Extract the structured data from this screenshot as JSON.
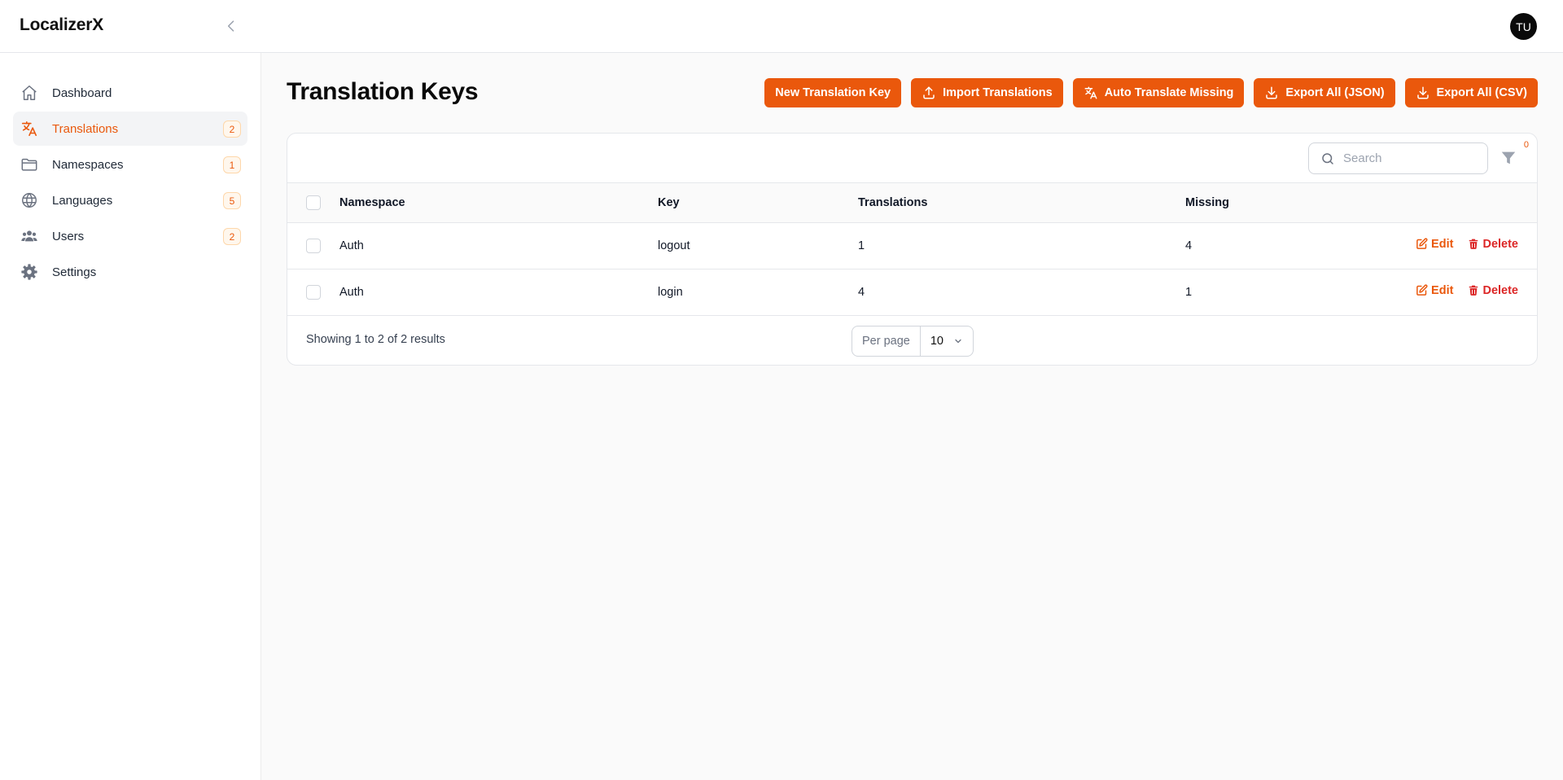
{
  "app": {
    "brand": "LocalizerX",
    "user_initials": "TU"
  },
  "sidebar": {
    "items": [
      {
        "label": "Dashboard",
        "icon": "home-icon",
        "badge": null,
        "active": false
      },
      {
        "label": "Translations",
        "icon": "language-icon",
        "badge": "2",
        "active": true
      },
      {
        "label": "Namespaces",
        "icon": "folder-icon",
        "badge": "1",
        "active": false
      },
      {
        "label": "Languages",
        "icon": "globe-icon",
        "badge": "5",
        "active": false
      },
      {
        "label": "Users",
        "icon": "users-icon",
        "badge": "2",
        "active": false
      },
      {
        "label": "Settings",
        "icon": "gear-icon",
        "badge": null,
        "active": false
      }
    ]
  },
  "page": {
    "title": "Translation Keys",
    "actions": [
      {
        "label": "New Translation Key",
        "icon": null
      },
      {
        "label": "Import Translations",
        "icon": "upload-icon"
      },
      {
        "label": "Auto Translate Missing",
        "icon": "language-icon"
      },
      {
        "label": "Export All (JSON)",
        "icon": "download-icon"
      },
      {
        "label": "Export All (CSV)",
        "icon": "download-icon"
      }
    ]
  },
  "table": {
    "search_placeholder": "Search",
    "filter_count": "0",
    "columns": [
      "Namespace",
      "Key",
      "Translations",
      "Missing"
    ],
    "rows": [
      {
        "namespace": "Auth",
        "key": "logout",
        "translations": "1",
        "missing": "4"
      },
      {
        "namespace": "Auth",
        "key": "login",
        "translations": "4",
        "missing": "1"
      }
    ],
    "row_actions": {
      "edit": "Edit",
      "delete": "Delete"
    },
    "footer": {
      "result_text": "Showing 1 to 2 of 2 results",
      "per_page_label": "Per page",
      "per_page_value": "10"
    }
  },
  "colors": {
    "accent": "#ea580c",
    "danger": "#dc2626"
  }
}
